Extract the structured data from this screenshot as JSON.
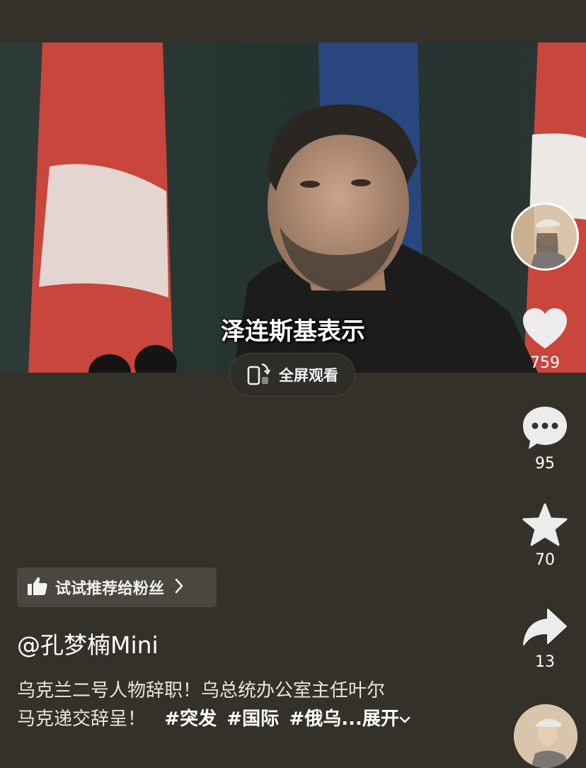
{
  "video": {
    "subtitle": "泽连斯基表示",
    "fullscreen_label": "全屏观看"
  },
  "actions": {
    "like_count": "759",
    "comment_count": "95",
    "favorite_count": "70",
    "share_count": "13"
  },
  "recommend": {
    "label": "试试推荐给粉丝"
  },
  "post": {
    "username": "@孔梦楠Mini",
    "description_line1": "乌克兰二号人物辞职！乌总统办公室主任叶尔",
    "description_line2": "马克递交辞呈！",
    "tags": [
      "#突发",
      "#国际",
      "#俄乌..."
    ],
    "expand_label": "展开"
  },
  "colors": {
    "background": "#34312b",
    "like_heart": "#ececec",
    "button_bg": "#4a4741"
  }
}
